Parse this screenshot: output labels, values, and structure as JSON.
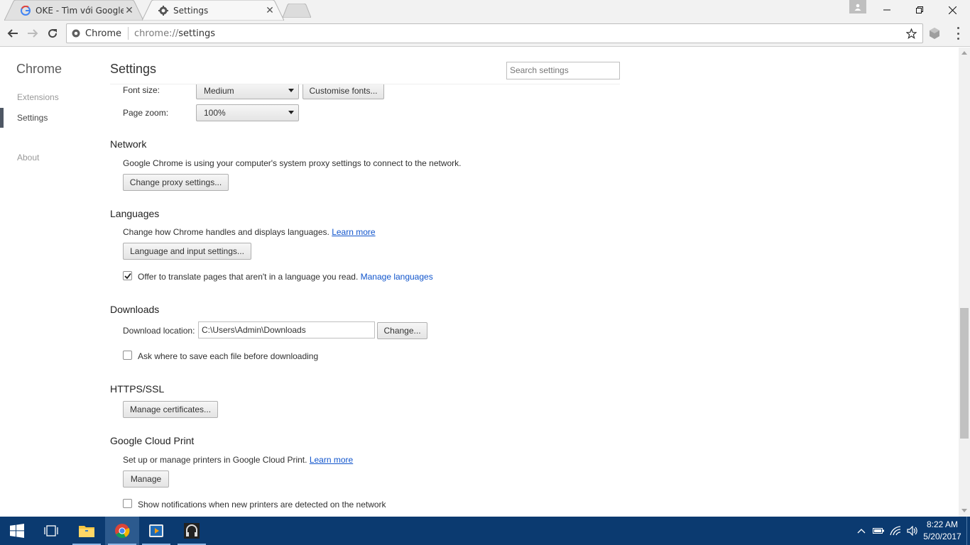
{
  "tabs": [
    {
      "title": "OKE - Tìm với Google",
      "favicon": "google-g-icon"
    },
    {
      "title": "Settings",
      "favicon": "gear-icon"
    }
  ],
  "omnibox": {
    "chip": "Chrome",
    "scheme": "chrome://",
    "path": "settings"
  },
  "sidebar": {
    "title": "Chrome",
    "items": [
      {
        "label": "Extensions"
      },
      {
        "label": "Settings"
      },
      {
        "label": "About"
      }
    ]
  },
  "header": {
    "title": "Settings",
    "search_placeholder": "Search settings"
  },
  "web_content": {
    "font_size_label": "Font size:",
    "font_size_value": "Medium",
    "customise_fonts_button": "Customise fonts...",
    "page_zoom_label": "Page zoom:",
    "page_zoom_value": "100%"
  },
  "network": {
    "title": "Network",
    "description": "Google Chrome is using your computer's system proxy settings to connect to the network.",
    "button": "Change proxy settings..."
  },
  "languages": {
    "title": "Languages",
    "description": "Change how Chrome handles and displays languages.",
    "learn_more": "Learn more",
    "button": "Language and input settings...",
    "translate_label": "Offer to translate pages that aren't in a language you read.",
    "translate_checked": true,
    "manage_languages": "Manage languages"
  },
  "downloads": {
    "title": "Downloads",
    "location_label": "Download location:",
    "location_value": "C:\\Users\\Admin\\Downloads",
    "change_button": "Change...",
    "ask_label": "Ask where to save each file before downloading",
    "ask_checked": false
  },
  "https": {
    "title": "HTTPS/SSL",
    "button": "Manage certificates..."
  },
  "cloud_print": {
    "title": "Google Cloud Print",
    "description": "Set up or manage printers in Google Cloud Print.",
    "learn_more": "Learn more",
    "button": "Manage",
    "notify_label": "Show notifications when new printers are detected on the network",
    "notify_checked": false
  },
  "taskbar": {
    "apps": [
      "start-icon",
      "task-view-icon",
      "file-explorer-icon",
      "chrome-icon",
      "media-player-icon",
      "headphones-app-icon"
    ],
    "time": "8:22 AM",
    "date": "5/20/2017"
  },
  "colors": {
    "taskbar": "#0b3a70",
    "link": "#1155cc",
    "accent_bar": "#4e5764"
  }
}
